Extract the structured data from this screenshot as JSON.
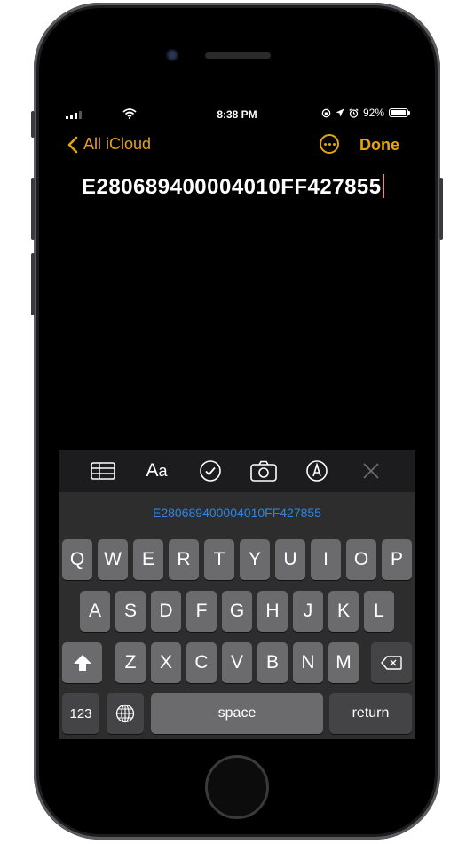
{
  "status_bar": {
    "time": "8:38 PM",
    "battery_percent": "92%",
    "battery_level": 0.92
  },
  "nav": {
    "back_label": "All iCloud",
    "done_label": "Done"
  },
  "note": {
    "text": "E280689400004010FF427855"
  },
  "toolbar": {
    "items": [
      "table-icon",
      "text-format-icon",
      "checklist-icon",
      "camera-icon",
      "markup-icon",
      "close-icon"
    ],
    "format_label_big": "A",
    "format_label_small": "a"
  },
  "keyboard": {
    "prediction": "E280689400004010FF427855",
    "row1": [
      "Q",
      "W",
      "E",
      "R",
      "T",
      "Y",
      "U",
      "I",
      "O",
      "P"
    ],
    "row2": [
      "A",
      "S",
      "D",
      "F",
      "G",
      "H",
      "J",
      "K",
      "L"
    ],
    "row3": [
      "Z",
      "X",
      "C",
      "V",
      "B",
      "N",
      "M"
    ],
    "numbers_label": "123",
    "space_label": "space",
    "return_label": "return"
  },
  "colors": {
    "accent": "#e5a50a",
    "prediction": "#2f85e6",
    "key": "#6b6b6e",
    "key_fn": "#444446"
  }
}
